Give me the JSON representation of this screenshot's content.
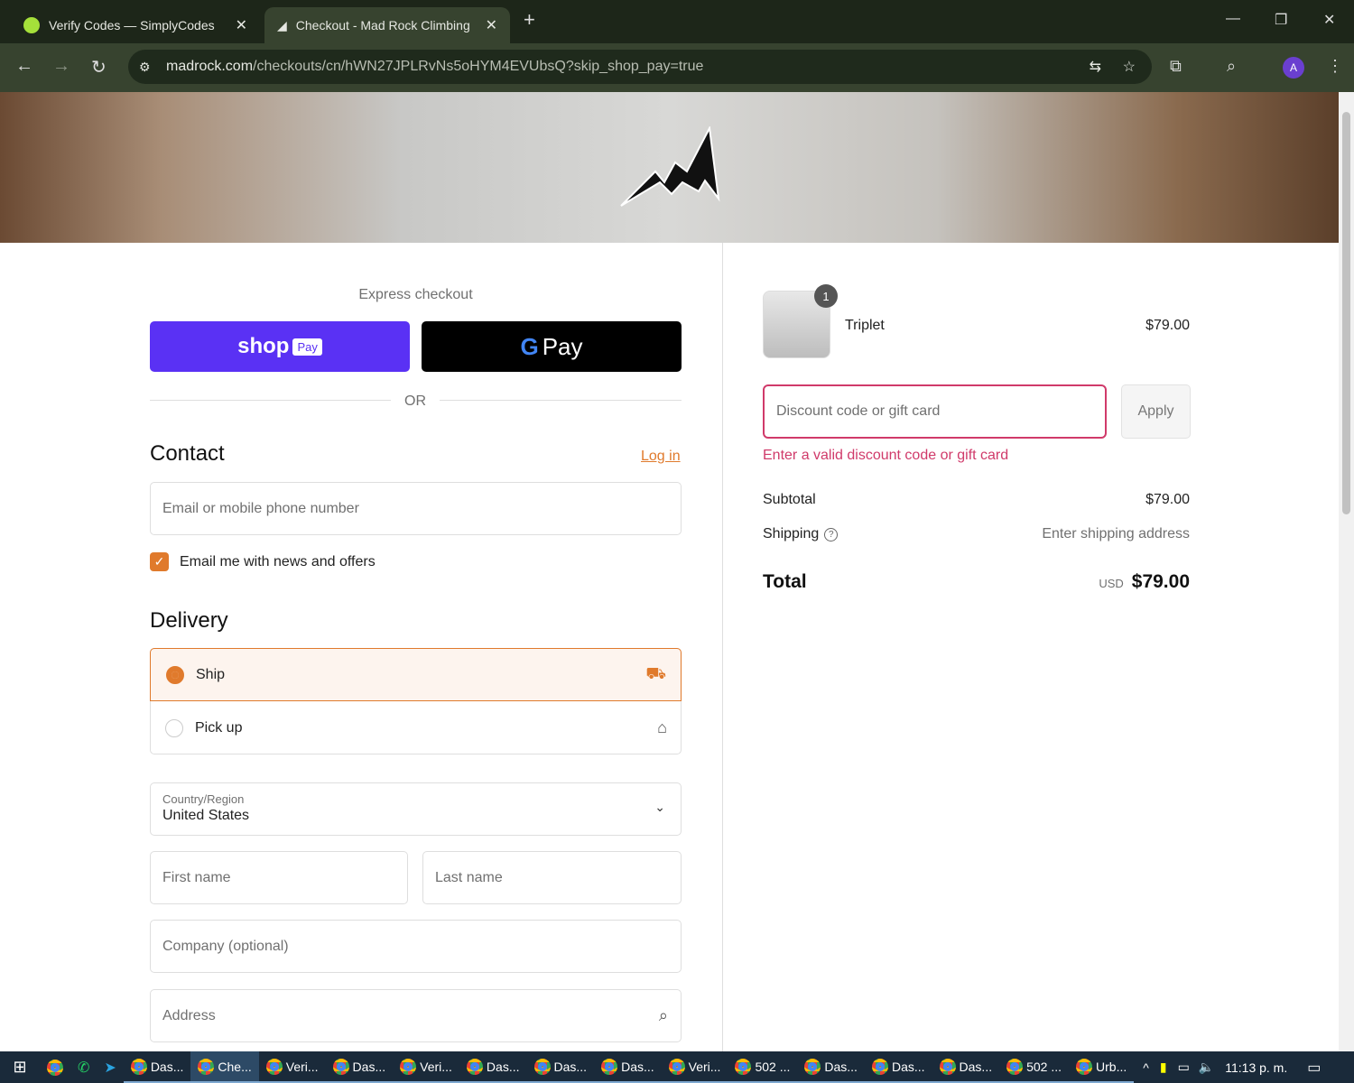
{
  "browser": {
    "tabs": [
      {
        "title": "Verify Codes — SimplyCodes",
        "active": false
      },
      {
        "title": "Checkout - Mad Rock Climbing",
        "active": true
      }
    ],
    "url_host": "madrock.com",
    "url_path": "/checkouts/cn/hWN27JPLRvNs5oHYM4EVUbsQ?skip_shop_pay=true",
    "profile_initial": "A"
  },
  "express": {
    "heading": "Express checkout",
    "shop_label": "shop",
    "shop_badge": "Pay",
    "gpay_label": "Pay",
    "or": "OR"
  },
  "contact": {
    "heading": "Contact",
    "login": "Log in",
    "email_placeholder": "Email or mobile phone number",
    "newsletter": "Email me with news and offers",
    "newsletter_checked": true
  },
  "delivery": {
    "heading": "Delivery",
    "options": [
      {
        "label": "Ship",
        "selected": true
      },
      {
        "label": "Pick up",
        "selected": false
      }
    ],
    "country_label": "Country/Region",
    "country_value": "United States",
    "first_name": "First name",
    "last_name": "Last name",
    "company": "Company (optional)",
    "address": "Address"
  },
  "summary": {
    "item": {
      "name": "Triplet",
      "price": "$79.00",
      "qty": "1"
    },
    "discount_placeholder": "Discount code or gift card",
    "apply": "Apply",
    "discount_error": "Enter a valid discount code or gift card",
    "subtotal_label": "Subtotal",
    "subtotal": "$79.00",
    "shipping_label": "Shipping",
    "shipping_value": "Enter shipping address",
    "total_label": "Total",
    "currency": "USD",
    "total": "$79.00"
  },
  "taskbar": {
    "items": [
      "Das...",
      "Che...",
      "Veri...",
      "Das...",
      "Veri...",
      "Das...",
      "Das...",
      "Das...",
      "Veri...",
      "502 ...",
      "Das...",
      "Das...",
      "Das...",
      "502 ...",
      "Urb..."
    ],
    "clock": "11:13 p. m."
  },
  "colors": {
    "accent": "#e07a2c",
    "error": "#d03a6a",
    "shop": "#5a31f4"
  }
}
